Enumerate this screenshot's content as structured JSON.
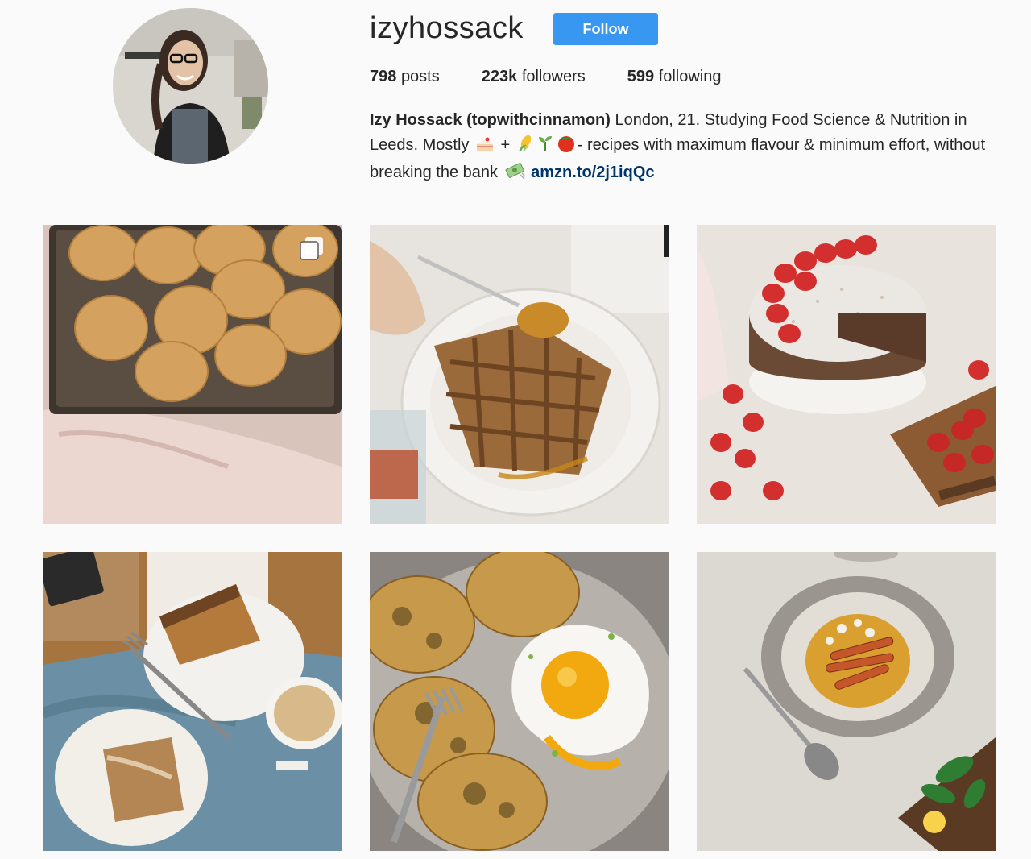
{
  "profile": {
    "username": "izyhossack",
    "follow_label": "Follow",
    "avatar": "profile-photo"
  },
  "stats": {
    "posts_count": "798",
    "posts_label": "posts",
    "followers_count": "223k",
    "followers_label": "followers",
    "following_count": "599",
    "following_label": "following"
  },
  "bio": {
    "name": "Izy Hossack (topwithcinnamon)",
    "line1": " London, 21. Studying Food Science & Nutrition in Leeds. Mostly ",
    "plus": " + ",
    "line2": "- recipes with maximum flavour & minimum effort, without breaking the bank ",
    "link": "amzn.to/2j1iqQc",
    "emojis": [
      "cake-emoji",
      "corn-emoji",
      "seedling-emoji",
      "tomato-emoji",
      "money-emoji"
    ]
  },
  "posts": [
    {
      "name": "pancakes-on-tray",
      "multi": true
    },
    {
      "name": "waffle-with-syrup",
      "multi": false
    },
    {
      "name": "strawberry-coconut-cake",
      "multi": false
    },
    {
      "name": "banana-bread-and-tea",
      "multi": false
    },
    {
      "name": "fritters-with-fried-egg",
      "multi": false
    },
    {
      "name": "lentil-dal-with-carrots",
      "multi": false
    }
  ],
  "colors": {
    "background": "#fafafa",
    "follow_button": "#3897f0",
    "link": "#003569",
    "text": "#262626"
  }
}
